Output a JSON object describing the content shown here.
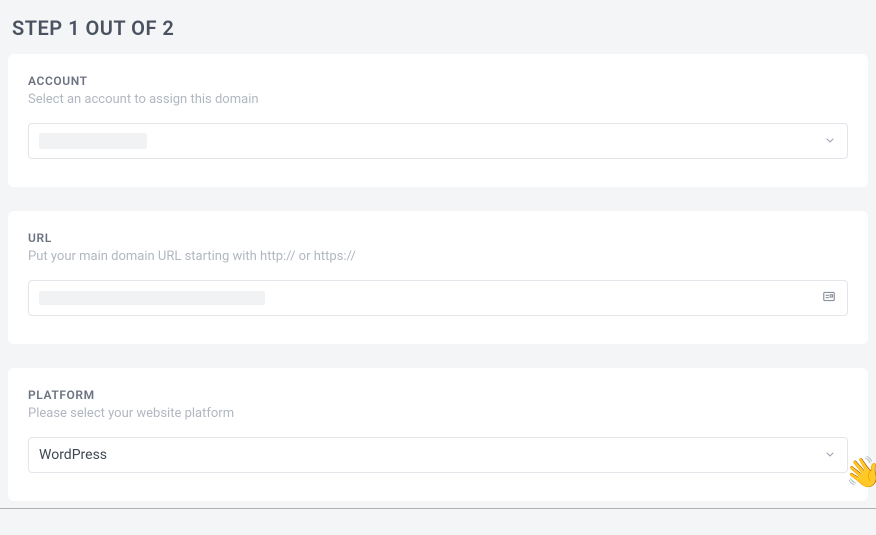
{
  "step": {
    "title": "STEP 1 OUT OF 2"
  },
  "account": {
    "label": "ACCOUNT",
    "desc": "Select an account to assign this domain",
    "value": ""
  },
  "url": {
    "label": "URL",
    "desc": "Put your main domain URL starting with http:// or https://",
    "value": ""
  },
  "platform": {
    "label": "PLATFORM",
    "desc": "Please select your website platform",
    "value": "WordPress"
  },
  "widget": {
    "emoji": "👋"
  }
}
